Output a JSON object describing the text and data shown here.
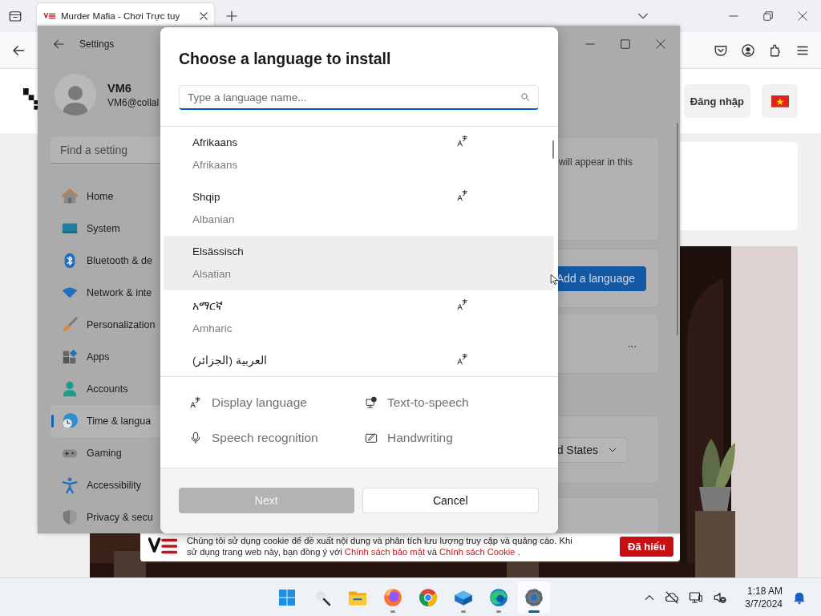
{
  "browser": {
    "tab": {
      "title": "Murder Mafia - Chơi Trực tuy"
    },
    "page": {
      "login_button": "Đăng nhập",
      "cookie_banner": {
        "line1": "Chúng tôi sử dụng cookie để đề xuất nội dung và phân tích lưu lượng truy cập và quảng cáo. Khi",
        "line2": "sử dụng trang web này, bạn đồng ý với",
        "link1": "Chính sách bảo mật",
        "joiner": "và",
        "link2": "Chính sách Cookie",
        "end": ".",
        "button": "Đã hiểu"
      }
    }
  },
  "settings": {
    "title": "Settings",
    "user": {
      "name": "VM6",
      "email": "VM6@collal"
    },
    "search": {
      "placeholder": "Find a setting"
    },
    "nav": [
      {
        "label": "Home",
        "kind": "home",
        "selected": false
      },
      {
        "label": "System",
        "kind": "system",
        "selected": false
      },
      {
        "label": "Bluetooth & de",
        "kind": "bluetooth",
        "selected": false
      },
      {
        "label": "Network & inte",
        "kind": "network",
        "selected": false
      },
      {
        "label": "Personalization",
        "kind": "personalization",
        "selected": false
      },
      {
        "label": "Apps",
        "kind": "apps",
        "selected": false
      },
      {
        "label": "Accounts",
        "kind": "accounts",
        "selected": false
      },
      {
        "label": "Time & langua",
        "kind": "time",
        "selected": true
      },
      {
        "label": "Gaming",
        "kind": "gaming",
        "selected": false
      },
      {
        "label": "Accessibility",
        "kind": "accessibility",
        "selected": false
      },
      {
        "label": "Privacy & secu",
        "kind": "privacy",
        "selected": false
      }
    ],
    "content": {
      "hint": "will appear in this",
      "add_button": "Add a language",
      "more": "...",
      "region_value": "d States"
    }
  },
  "dialog": {
    "title": "Choose a language to install",
    "search": {
      "placeholder": "Type a language name..."
    },
    "languages": [
      {
        "name": "Afrikaans",
        "english": "Afrikaans",
        "display_language": true,
        "hovered": false
      },
      {
        "name": "Shqip",
        "english": "Albanian",
        "display_language": true,
        "hovered": false
      },
      {
        "name": "Elsässisch",
        "english": "Alsatian",
        "display_language": false,
        "hovered": true
      },
      {
        "name": "አማርኛ",
        "english": "Amharic",
        "display_language": true,
        "hovered": false
      },
      {
        "name": "العربية (الجزائر)",
        "display_language": true,
        "hovered": false
      }
    ],
    "features": [
      {
        "kind": "display",
        "label": "Display language"
      },
      {
        "kind": "tts",
        "label": "Text-to-speech"
      },
      {
        "kind": "speech",
        "label": "Speech recognition"
      },
      {
        "kind": "handwriting",
        "label": "Handwriting"
      }
    ],
    "buttons": [
      {
        "label": "Next",
        "kind": "primary",
        "disabled": true
      },
      {
        "label": "Cancel",
        "kind": "secondary",
        "disabled": false
      }
    ]
  },
  "taskbar": {
    "apps": [
      {
        "kind": "start",
        "running": false,
        "selected": false
      },
      {
        "kind": "search",
        "running": false,
        "selected": false
      },
      {
        "kind": "folder",
        "running": false,
        "selected": false
      },
      {
        "kind": "firefox",
        "running": true,
        "selected": false
      },
      {
        "kind": "chrome",
        "running": false,
        "selected": false
      },
      {
        "kind": "box",
        "running": true,
        "selected": false
      },
      {
        "kind": "edge",
        "running": true,
        "selected": false
      },
      {
        "kind": "settings",
        "running": true,
        "selected": true
      }
    ],
    "clock": {
      "time": "1:18 AM",
      "date": "3/7/2024"
    }
  }
}
